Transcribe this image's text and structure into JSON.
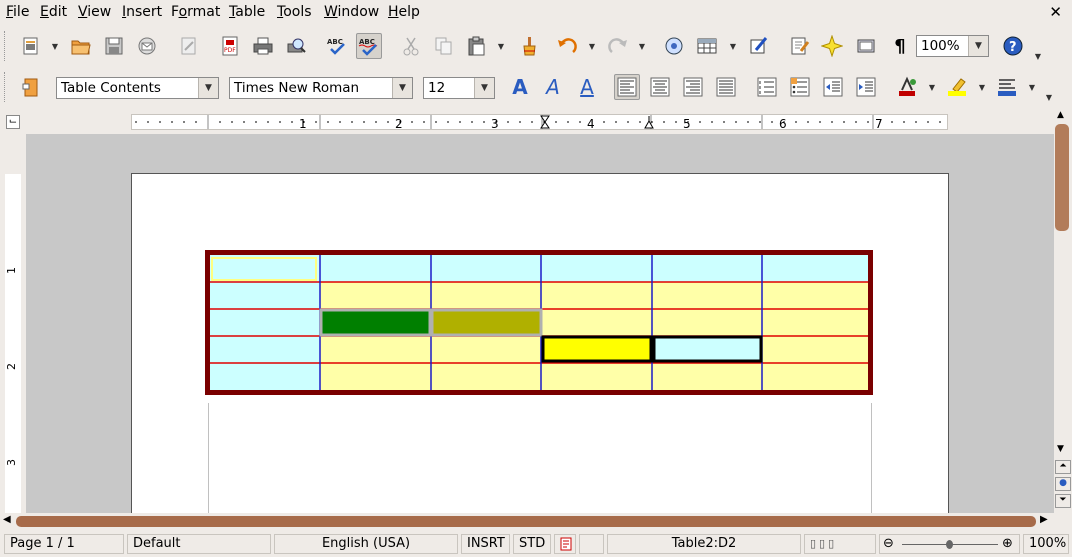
{
  "menu": [
    "File",
    "Edit",
    "View",
    "Insert",
    "Format",
    "Table",
    "Tools",
    "Window",
    "Help"
  ],
  "menu_accel": [
    "F",
    "E",
    "V",
    "I",
    "o",
    "T",
    "T",
    "W",
    "H"
  ],
  "toolbar": {
    "style_name": "Table Contents",
    "font_name": "Times New Roman",
    "font_size": "12",
    "zoom": "100%"
  },
  "ruler": {
    "numbers": [
      "1",
      "2",
      "3",
      "4",
      "5",
      "6",
      "7"
    ],
    "vertical_numbers": [
      "1",
      "2",
      "3"
    ]
  },
  "status": {
    "page": "Page 1 / 1",
    "style": "Default",
    "language": "English (USA)",
    "mode": "INSRT",
    "selection": "STD",
    "cell": "Table2:D2",
    "zoom": "100%"
  },
  "colors": {
    "table_border": "#7a0000",
    "row_line": "#e00000",
    "col_line": "#1c1cc8",
    "col_a_bg": "#ccffff",
    "body_bg": "#ffffa8",
    "green_block": "#007f00",
    "olive_block": "#b0b000",
    "yellow_block": "#ffff00",
    "scroll_thumb": "#a76b4a"
  },
  "icons": [
    "new-icon",
    "open-icon",
    "save-icon",
    "email-icon",
    "edit-file-icon",
    "export-pdf-icon",
    "print-icon",
    "print-preview-icon",
    "spellcheck-icon",
    "autospellcheck-icon",
    "cut-icon",
    "copy-icon",
    "paste-icon",
    "format-paintbrush-icon",
    "undo-icon",
    "redo-icon",
    "navigator-icon",
    "table-icon",
    "show-draw-functions-icon",
    "find-replace-icon",
    "gallery-icon",
    "data-sources-icon",
    "nonprinting-characters-icon",
    "help-icon"
  ]
}
